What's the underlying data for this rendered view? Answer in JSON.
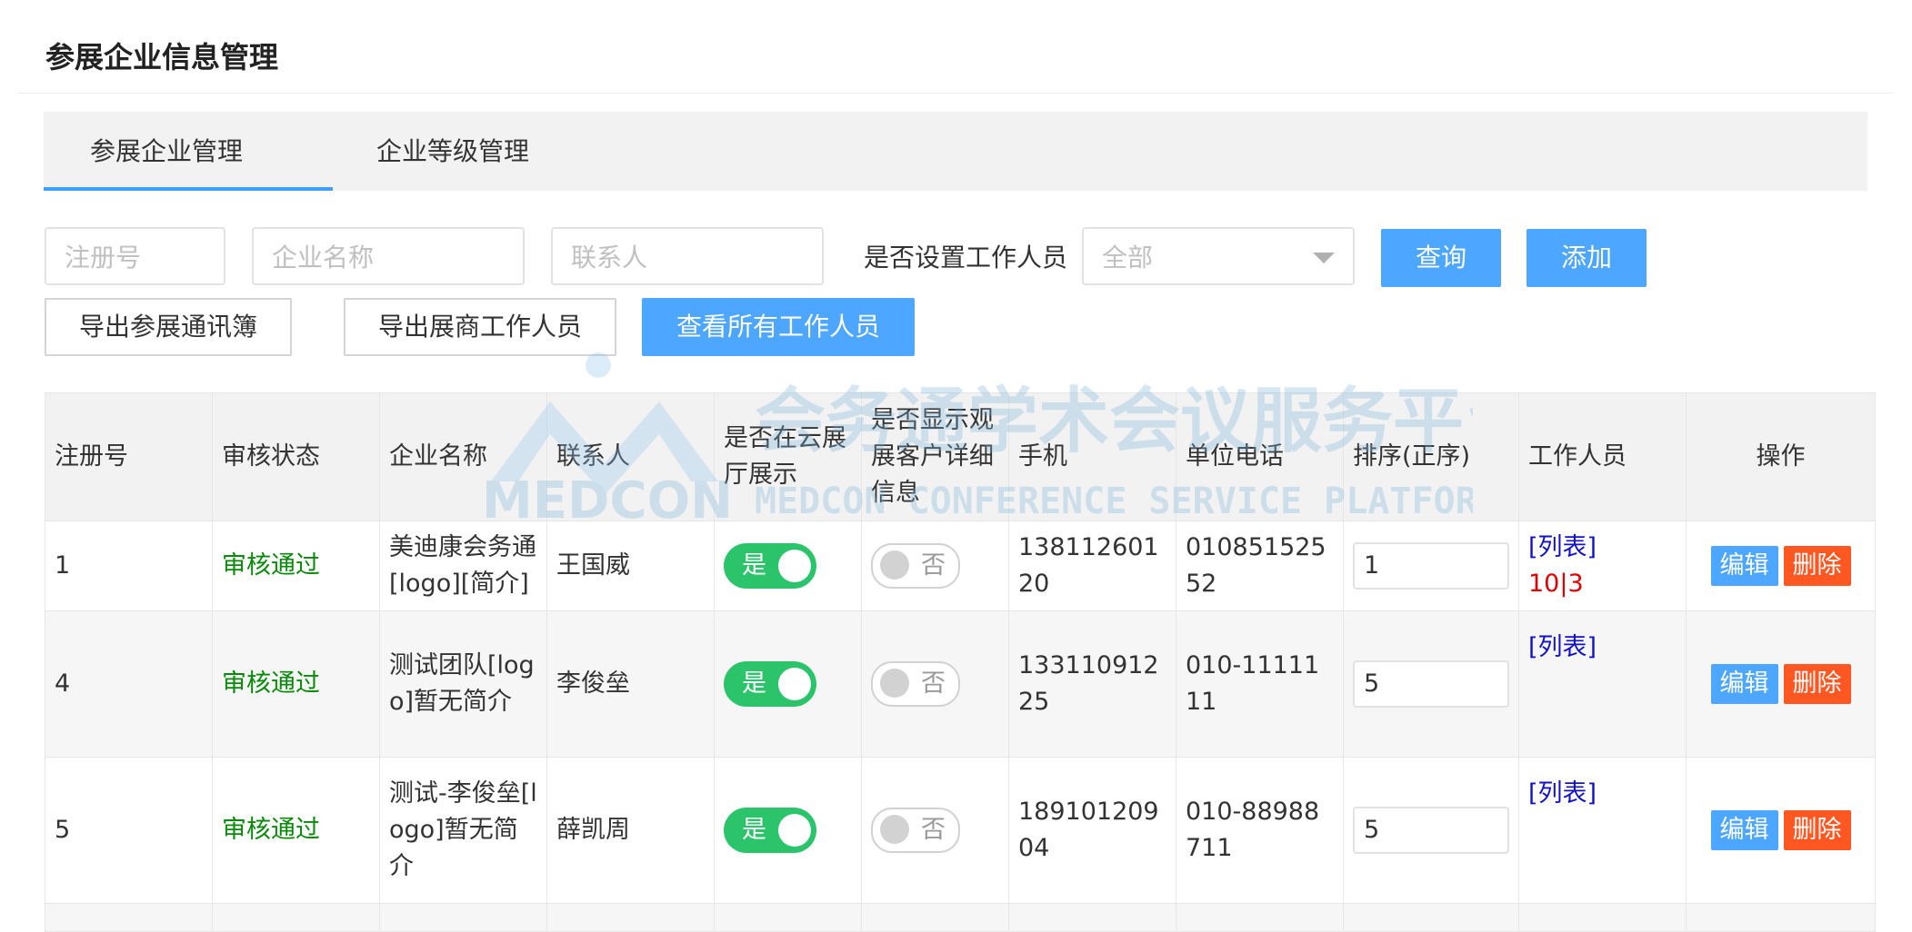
{
  "page": {
    "title": "参展企业信息管理"
  },
  "tabs": [
    {
      "label": "参展企业管理",
      "active": true
    },
    {
      "label": "企业等级管理",
      "active": false
    }
  ],
  "filters": {
    "reg_no_placeholder": "注册号",
    "company_placeholder": "企业名称",
    "contact_placeholder": "联系人",
    "staff_label": "是否设置工作人员",
    "staff_select_value": "全部",
    "query_label": "查询",
    "add_label": "添加",
    "export_contacts_label": "导出参展通讯簿",
    "export_staff_label": "导出展商工作人员",
    "view_all_staff_label": "查看所有工作人员"
  },
  "watermark": {
    "title": "会务通学术会议服务平台",
    "logo_text": "MEDCON",
    "subtitle": "MEDCON CONFERENCE SERVICE PLATFORM"
  },
  "table": {
    "headers": [
      "注册号",
      "审核状态",
      "企业名称",
      "联系人",
      "是否在云展厅展示",
      "是否显示观展客户详细信息",
      "手机",
      "单位电话",
      "排序(正序)",
      "工作人员",
      "操作"
    ],
    "rows": [
      {
        "reg_no": "1",
        "status": "审核通过",
        "company": "美迪康会务通[logo][简介]",
        "contact": "王国威",
        "cloud": "是",
        "detail": "否",
        "mobile": "13811260120",
        "phone": "01085152552",
        "sort": "1",
        "staff_link": "[列表]",
        "staff_count": "10|3",
        "edit": "编辑",
        "delete": "删除"
      },
      {
        "reg_no": "4",
        "status": "审核通过",
        "company": "测试团队[logo]暂无简介",
        "contact": "李俊垒",
        "cloud": "是",
        "detail": "否",
        "mobile": "13311091225",
        "phone": "010-1111111",
        "sort": "5",
        "staff_link": "[列表]",
        "staff_count": "",
        "edit": "编辑",
        "delete": "删除"
      },
      {
        "reg_no": "5",
        "status": "审核通过",
        "company": "测试-李俊垒[logo]暂无简介",
        "contact": "薛凯周",
        "cloud": "是",
        "detail": "否",
        "mobile": "18910120904",
        "phone": "010-88988711",
        "sort": "5",
        "staff_link": "[列表]",
        "staff_count": "",
        "edit": "编辑",
        "delete": "删除"
      }
    ]
  },
  "colors": {
    "accent": "#409eff",
    "button_blue": "#4da6ff",
    "status_green": "#0a8a0a",
    "toggle_green": "#2cc46b",
    "delete_orange": "#ff5722",
    "link_blue": "#1111cc",
    "count_red": "#e00000"
  }
}
